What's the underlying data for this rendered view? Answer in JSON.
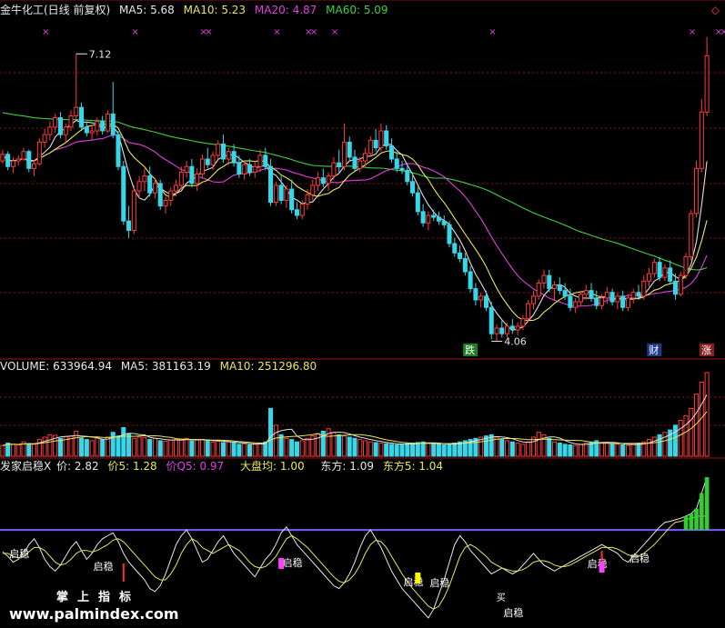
{
  "colors": {
    "bg": "#000000",
    "up": "#ff3b3b",
    "down": "#36d7e8",
    "ma5": "#e0e0e0",
    "ma10": "#e8e85a",
    "ma20": "#e040e0",
    "ma60": "#40d040",
    "grid": "#8a1010"
  },
  "header": {
    "title": "金牛化工(日线 前复权)",
    "ma5": "MA5: 5.68",
    "ma10": "MA10: 5.23",
    "ma20": "MA20: 4.87",
    "ma60": "MA60: 5.09",
    "corner_icon": "diamond-icon"
  },
  "volume_header": {
    "volume": "VOLUME: 633964.94",
    "ma5": "MA5: 381163.19",
    "ma10": "MA10: 251296.80"
  },
  "indicator_header": {
    "name": "发家启稳X",
    "jia": "价: 2.82",
    "jia5": "价5: 1.28",
    "jiaq5": "价Q5: 0.97",
    "dapan": "大盘均: 1.00",
    "dongfang": "东方: 1.09",
    "dongfang5": "东方5: 1.04"
  },
  "annotations": {
    "high_label": "7.12",
    "low_label": "4.06",
    "tag_die": "跌",
    "tag_cai": "财",
    "tag_zhang": "涨",
    "qiwen": "启稳",
    "mai": "买"
  },
  "watermark": {
    "brand": "掌上指标",
    "url": "www.palmindex.com"
  },
  "chart_data": [
    {
      "type": "candlestick",
      "title": "金牛化工(日线 前复权)",
      "ylim": [
        3.9,
        7.5
      ],
      "high_marked": 7.12,
      "low_marked": 4.06,
      "candles": [
        [
          5.98,
          6.1,
          5.95,
          6.05
        ],
        [
          6.05,
          6.08,
          5.88,
          5.92
        ],
        [
          5.92,
          6.02,
          5.85,
          5.98
        ],
        [
          5.98,
          6.04,
          5.93,
          6.0
        ],
        [
          6.0,
          6.12,
          5.98,
          6.08
        ],
        [
          6.08,
          6.1,
          5.86,
          5.9
        ],
        [
          5.9,
          5.99,
          5.82,
          5.95
        ],
        [
          5.95,
          6.22,
          5.93,
          6.18
        ],
        [
          6.18,
          6.32,
          6.12,
          6.26
        ],
        [
          6.26,
          6.4,
          6.2,
          6.34
        ],
        [
          6.34,
          6.48,
          6.28,
          6.44
        ],
        [
          6.44,
          6.5,
          6.22,
          6.26
        ],
        [
          6.26,
          6.38,
          6.18,
          6.34
        ],
        [
          6.34,
          6.52,
          6.3,
          6.46
        ],
        [
          6.46,
          7.12,
          6.42,
          6.55
        ],
        [
          6.55,
          6.6,
          6.3,
          6.34
        ],
        [
          6.34,
          6.4,
          6.24,
          6.28
        ],
        [
          6.28,
          6.36,
          6.2,
          6.3
        ],
        [
          6.3,
          6.44,
          6.25,
          6.4
        ],
        [
          6.4,
          6.46,
          6.26,
          6.3
        ],
        [
          6.3,
          6.52,
          6.28,
          6.48
        ],
        [
          6.48,
          6.82,
          6.22,
          6.26
        ],
        [
          6.26,
          6.3,
          5.88,
          5.92
        ],
        [
          5.92,
          5.98,
          5.3,
          5.34
        ],
        [
          5.34,
          5.5,
          5.16,
          5.24
        ],
        [
          5.24,
          5.72,
          5.2,
          5.66
        ],
        [
          5.66,
          5.82,
          5.58,
          5.76
        ],
        [
          5.76,
          5.9,
          5.66,
          5.82
        ],
        [
          5.82,
          5.92,
          5.6,
          5.64
        ],
        [
          5.64,
          5.8,
          5.58,
          5.74
        ],
        [
          5.74,
          5.78,
          5.46,
          5.5
        ],
        [
          5.5,
          5.6,
          5.42,
          5.56
        ],
        [
          5.56,
          5.7,
          5.5,
          5.66
        ],
        [
          5.66,
          5.78,
          5.6,
          5.72
        ],
        [
          5.72,
          5.92,
          5.68,
          5.86
        ],
        [
          5.86,
          5.98,
          5.8,
          5.92
        ],
        [
          5.92,
          6.0,
          5.7,
          5.74
        ],
        [
          5.74,
          5.9,
          5.66,
          5.84
        ],
        [
          5.84,
          6.05,
          5.8,
          6.0
        ],
        [
          6.0,
          6.12,
          5.9,
          5.94
        ],
        [
          5.94,
          6.08,
          5.88,
          6.04
        ],
        [
          6.04,
          6.2,
          6.0,
          6.16
        ],
        [
          6.16,
          6.26,
          5.96,
          6.0
        ],
        [
          6.0,
          6.12,
          5.94,
          6.08
        ],
        [
          6.08,
          6.16,
          5.92,
          5.96
        ],
        [
          5.96,
          6.04,
          5.8,
          5.84
        ],
        [
          5.84,
          5.98,
          5.78,
          5.94
        ],
        [
          5.94,
          6.0,
          5.82,
          5.86
        ],
        [
          5.86,
          5.98,
          5.8,
          5.92
        ],
        [
          5.92,
          6.1,
          5.86,
          6.04
        ],
        [
          6.04,
          6.12,
          5.88,
          5.92
        ],
        [
          5.92,
          6.0,
          5.5,
          5.54
        ],
        [
          5.54,
          5.76,
          5.5,
          5.72
        ],
        [
          5.72,
          5.82,
          5.52,
          5.56
        ],
        [
          5.56,
          5.72,
          5.48,
          5.68
        ],
        [
          5.68,
          5.78,
          5.42,
          5.46
        ],
        [
          5.46,
          5.54,
          5.36,
          5.4
        ],
        [
          5.4,
          5.56,
          5.36,
          5.52
        ],
        [
          5.52,
          5.68,
          5.46,
          5.62
        ],
        [
          5.62,
          5.78,
          5.56,
          5.72
        ],
        [
          5.72,
          5.86,
          5.66,
          5.8
        ],
        [
          5.8,
          5.9,
          5.7,
          5.74
        ],
        [
          5.74,
          5.86,
          5.66,
          5.82
        ],
        [
          5.82,
          6.02,
          5.78,
          5.96
        ],
        [
          5.96,
          6.1,
          5.86,
          5.92
        ],
        [
          5.92,
          6.38,
          5.88,
          6.18
        ],
        [
          6.18,
          6.24,
          5.98,
          6.02
        ],
        [
          6.02,
          6.1,
          5.86,
          5.9
        ],
        [
          5.9,
          6.02,
          5.86,
          5.98
        ],
        [
          5.98,
          6.12,
          5.92,
          6.06
        ],
        [
          6.06,
          6.24,
          6.02,
          6.2
        ],
        [
          6.2,
          6.32,
          6.08,
          6.12
        ],
        [
          6.12,
          6.38,
          6.08,
          6.3
        ],
        [
          6.3,
          6.36,
          6.1,
          6.14
        ],
        [
          6.14,
          6.22,
          5.96,
          6.0
        ],
        [
          6.0,
          6.08,
          5.86,
          5.9
        ],
        [
          5.9,
          5.98,
          5.84,
          5.88
        ],
        [
          5.88,
          5.94,
          5.72,
          5.76
        ],
        [
          5.76,
          5.84,
          5.6,
          5.64
        ],
        [
          5.64,
          5.7,
          5.4,
          5.44
        ],
        [
          5.44,
          5.52,
          5.28,
          5.32
        ],
        [
          5.32,
          5.44,
          5.24,
          5.4
        ],
        [
          5.4,
          5.46,
          5.34,
          5.38
        ],
        [
          5.38,
          5.44,
          5.3,
          5.34
        ],
        [
          5.34,
          5.4,
          5.26,
          5.3
        ],
        [
          5.3,
          5.34,
          5.06,
          5.1
        ],
        [
          5.1,
          5.16,
          4.96,
          5.0
        ],
        [
          5.0,
          5.08,
          4.9,
          4.94
        ],
        [
          4.94,
          5.0,
          4.76,
          4.8
        ],
        [
          4.8,
          4.86,
          4.58,
          4.62
        ],
        [
          4.62,
          4.68,
          4.44,
          4.5
        ],
        [
          4.5,
          4.58,
          4.42,
          4.54
        ],
        [
          4.54,
          4.6,
          4.38,
          4.42
        ],
        [
          4.42,
          4.48,
          4.08,
          4.14
        ],
        [
          4.14,
          4.24,
          4.06,
          4.2
        ],
        [
          4.2,
          4.28,
          4.1,
          4.14
        ],
        [
          4.14,
          4.26,
          4.1,
          4.22
        ],
        [
          4.22,
          4.3,
          4.14,
          4.18
        ],
        [
          4.18,
          4.26,
          4.12,
          4.22
        ],
        [
          4.22,
          4.34,
          4.18,
          4.3
        ],
        [
          4.3,
          4.5,
          4.26,
          4.46
        ],
        [
          4.46,
          4.6,
          4.4,
          4.54
        ],
        [
          4.54,
          4.72,
          4.5,
          4.68
        ],
        [
          4.68,
          4.82,
          4.62,
          4.76
        ],
        [
          4.76,
          4.82,
          4.58,
          4.62
        ],
        [
          4.62,
          4.7,
          4.5,
          4.66
        ],
        [
          4.66,
          4.74,
          4.56,
          4.6
        ],
        [
          4.6,
          4.68,
          4.5,
          4.54
        ],
        [
          4.54,
          4.62,
          4.38,
          4.42
        ],
        [
          4.42,
          4.52,
          4.36,
          4.48
        ],
        [
          4.48,
          4.6,
          4.44,
          4.56
        ],
        [
          4.56,
          4.66,
          4.5,
          4.6
        ],
        [
          4.6,
          4.68,
          4.48,
          4.52
        ],
        [
          4.52,
          4.6,
          4.4,
          4.44
        ],
        [
          4.44,
          4.56,
          4.4,
          4.52
        ],
        [
          4.52,
          4.64,
          4.46,
          4.58
        ],
        [
          4.58,
          4.62,
          4.44,
          4.48
        ],
        [
          4.48,
          4.58,
          4.4,
          4.54
        ],
        [
          4.54,
          4.6,
          4.38,
          4.42
        ],
        [
          4.42,
          4.56,
          4.38,
          4.52
        ],
        [
          4.52,
          4.62,
          4.46,
          4.58
        ],
        [
          4.58,
          4.66,
          4.5,
          4.54
        ],
        [
          4.54,
          4.76,
          4.5,
          4.7
        ],
        [
          4.7,
          4.84,
          4.64,
          4.78
        ],
        [
          4.78,
          4.94,
          4.74,
          4.9
        ],
        [
          4.9,
          4.96,
          4.7,
          4.74
        ],
        [
          4.74,
          4.88,
          4.7,
          4.84
        ],
        [
          4.84,
          4.92,
          4.66,
          4.7
        ],
        [
          4.7,
          4.78,
          4.5,
          4.56
        ],
        [
          4.56,
          4.8,
          4.54,
          4.76
        ],
        [
          4.76,
          5.0,
          4.72,
          4.96
        ],
        [
          4.96,
          5.46,
          4.92,
          5.42
        ],
        [
          5.42,
          5.98,
          5.38,
          5.9
        ],
        [
          5.9,
          6.64,
          5.86,
          6.5
        ],
        [
          6.5,
          7.3,
          6.46,
          7.1
        ]
      ],
      "ma_lines": [
        "MA5",
        "MA10",
        "MA20",
        "MA60"
      ]
    },
    {
      "type": "bar",
      "title": "VOLUME",
      "values": [
        90,
        110,
        100,
        95,
        120,
        105,
        100,
        140,
        160,
        180,
        175,
        150,
        165,
        170,
        210,
        150,
        140,
        130,
        150,
        140,
        160,
        200,
        170,
        240,
        190,
        150,
        160,
        155,
        140,
        150,
        130,
        125,
        135,
        140,
        145,
        150,
        130,
        135,
        140,
        130,
        120,
        125,
        115,
        120,
        110,
        100,
        105,
        95,
        100,
        110,
        120,
        400,
        260,
        180,
        150,
        140,
        120,
        130,
        150,
        170,
        190,
        210,
        230,
        200,
        180,
        170,
        160,
        150,
        140,
        130,
        120,
        115,
        110,
        105,
        100,
        95,
        100,
        105,
        110,
        115,
        120,
        110,
        105,
        100,
        95,
        100,
        110,
        120,
        130,
        140,
        150,
        160,
        170,
        180,
        160,
        140,
        130,
        120,
        110,
        100,
        120,
        160,
        200,
        180,
        150,
        120,
        110,
        100,
        95,
        90,
        100,
        110,
        120,
        130,
        115,
        110,
        105,
        100,
        95,
        90,
        100,
        110,
        120,
        140,
        160,
        180,
        200,
        220,
        260,
        300,
        340,
        400,
        520,
        620,
        700
      ]
    },
    {
      "type": "line",
      "title": "发家启稳X",
      "series": [
        {
          "name": "价",
          "values": [
            0.85,
            0.82,
            0.78,
            0.8,
            0.84,
            0.9,
            0.94,
            0.88,
            0.8,
            0.75,
            0.72,
            0.76,
            0.82,
            0.88,
            0.92,
            0.86,
            0.8,
            0.84,
            0.9,
            0.94,
            0.96,
            0.98,
            0.92,
            0.84,
            0.78,
            0.74,
            0.7,
            0.66,
            0.6,
            0.58,
            0.62,
            0.7,
            0.8,
            0.9,
            0.96,
            1.0,
            0.94,
            0.86,
            0.78,
            0.8,
            0.86,
            0.92,
            0.96,
            0.9,
            0.84,
            0.8,
            0.76,
            0.72,
            0.68,
            0.74,
            0.8,
            0.84,
            0.9,
            0.98,
            1.02,
            0.96,
            0.9,
            0.86,
            0.82,
            0.78,
            0.74,
            0.7,
            0.66,
            0.62,
            0.6,
            0.64,
            0.7,
            0.78,
            0.88,
            0.96,
            1.0,
            0.94,
            0.88,
            0.8,
            0.72,
            0.66,
            0.6,
            0.56,
            0.52,
            0.48,
            0.44,
            0.4,
            0.46,
            0.56,
            0.66,
            0.78,
            0.9,
            0.96,
            0.92,
            0.86,
            0.82,
            0.78,
            0.74,
            0.7,
            0.72,
            0.74,
            0.72,
            0.7,
            0.72,
            0.76,
            0.8,
            0.84,
            0.8,
            0.76,
            0.74,
            0.72,
            0.74,
            0.76,
            0.78,
            0.8,
            0.82,
            0.84,
            0.86,
            0.88,
            0.9,
            0.88,
            0.86,
            0.84,
            0.8,
            0.78,
            0.82,
            0.86,
            0.9,
            0.94,
            0.98,
            1.02,
            1.06,
            1.1,
            1.16,
            1.22,
            1.3,
            1.4,
            1.6,
            2.2,
            2.82
          ]
        },
        {
          "name": "价5",
          "values": [
            0.84,
            0.84,
            0.82,
            0.81,
            0.82,
            0.85,
            0.88,
            0.88,
            0.86,
            0.82,
            0.78,
            0.76,
            0.77,
            0.8,
            0.84,
            0.86,
            0.86,
            0.85,
            0.86,
            0.88,
            0.9,
            0.93,
            0.94,
            0.92,
            0.88,
            0.84,
            0.8,
            0.76,
            0.72,
            0.68,
            0.66,
            0.66,
            0.7,
            0.76,
            0.84,
            0.9,
            0.94,
            0.92,
            0.88,
            0.86,
            0.84,
            0.86,
            0.88,
            0.9,
            0.88,
            0.86,
            0.82,
            0.78,
            0.75,
            0.74,
            0.75,
            0.78,
            0.82,
            0.88,
            0.94,
            0.96,
            0.94,
            0.91,
            0.88,
            0.84,
            0.8,
            0.76,
            0.72,
            0.68,
            0.65,
            0.64,
            0.66,
            0.7,
            0.76,
            0.84,
            0.9,
            0.93,
            0.92,
            0.88,
            0.82,
            0.76,
            0.7,
            0.65,
            0.6,
            0.56,
            0.52,
            0.48,
            0.46,
            0.48,
            0.54,
            0.62,
            0.72,
            0.82,
            0.88,
            0.9,
            0.88,
            0.85,
            0.82,
            0.78,
            0.76,
            0.74,
            0.73,
            0.72,
            0.72,
            0.73,
            0.75,
            0.78,
            0.79,
            0.79,
            0.78,
            0.76,
            0.75,
            0.75,
            0.76,
            0.78,
            0.8,
            0.82,
            0.84,
            0.86,
            0.88,
            0.88,
            0.88,
            0.87,
            0.85,
            0.83,
            0.82,
            0.82,
            0.84,
            0.87,
            0.9,
            0.94,
            0.98,
            1.02,
            1.06,
            1.1,
            1.16,
            1.22,
            1.28,
            1.32,
            1.28
          ]
        },
        {
          "name": "大盘均",
          "values": [
            1.0
          ]
        }
      ]
    }
  ]
}
